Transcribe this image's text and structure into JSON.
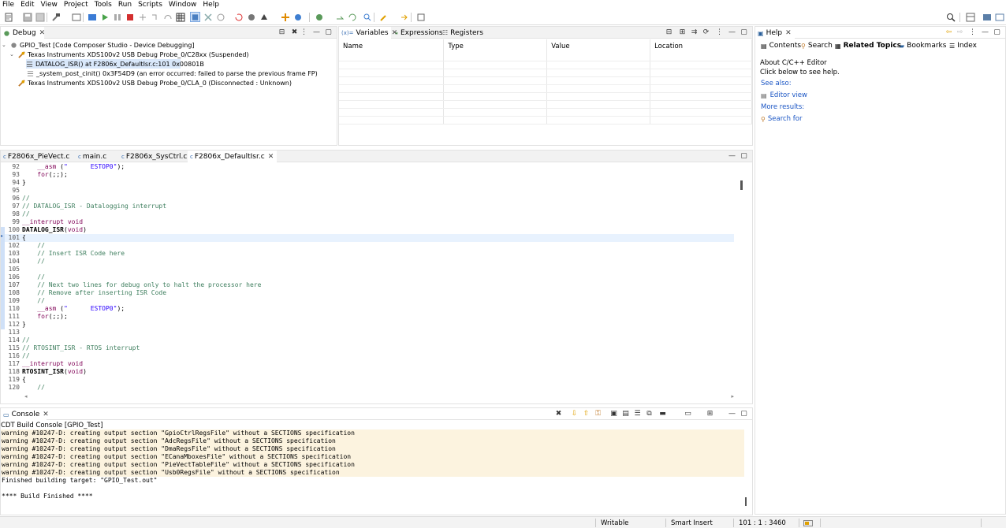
{
  "menu": [
    "File",
    "Edit",
    "View",
    "Project",
    "Tools",
    "Run",
    "Scripts",
    "Window",
    "Help"
  ],
  "debug_view": {
    "tab_label": "Debug",
    "tree": [
      {
        "text": "GPIO_Test [Code Composer Studio - Device Debugging]",
        "icon": "debug-session-icon"
      },
      {
        "text": "Texas Instruments XDS100v2 USB Debug Probe_0/C28xx (Suspended)",
        "icon": "debug-thread-icon"
      },
      {
        "text": "DATALOG_ISR() at F2806x_DefaultIsr.c:101 0x00801B",
        "icon": "stack-frame-icon"
      },
      {
        "text": "_system_post_cinit() 0x3F54D9  (an error occurred: failed to parse the previous frame FP)",
        "icon": "stack-frame-icon"
      },
      {
        "text": "Texas Instruments XDS100v2 USB Debug Probe_0/CLA_0 (Disconnected : Unknown)",
        "icon": "debug-disconnected-icon"
      }
    ]
  },
  "variables_view": {
    "tabs": [
      "Variables",
      "Expressions",
      "Registers"
    ],
    "columns": [
      "Name",
      "Type",
      "Value",
      "Location"
    ]
  },
  "help_view": {
    "tab_label": "Help",
    "tabs": [
      "Contents",
      "Search",
      "Related Topics",
      "Bookmarks",
      "Index"
    ],
    "about_title": "About C/C++ Editor",
    "about_hint": "Click below to see help.",
    "see_also": "See also:",
    "editor_view": "Editor view",
    "more_results": "More results:",
    "search_for": "Search for"
  },
  "editor": {
    "tabs": [
      "F2806x_PieVect.c",
      "main.c",
      "F2806x_SysCtrl.c",
      "F2806x_DefaultIsr.c"
    ],
    "lines": [
      {
        "n": "92",
        "t": "    __asm (\"      ESTOP0\");"
      },
      {
        "n": "93",
        "t": "    for(;;);"
      },
      {
        "n": "94",
        "t": "}"
      },
      {
        "n": "95",
        "t": ""
      },
      {
        "n": "96",
        "t": "//"
      },
      {
        "n": "97",
        "t": "// DATALOG_ISR - Datalogging interrupt"
      },
      {
        "n": "98",
        "t": "//"
      },
      {
        "n": "99",
        "t": "__interrupt void"
      },
      {
        "n": "100",
        "t": "DATALOG_ISR(void)"
      },
      {
        "n": "101",
        "t": "{"
      },
      {
        "n": "102",
        "t": "    //"
      },
      {
        "n": "103",
        "t": "    // Insert ISR Code here"
      },
      {
        "n": "104",
        "t": "    //"
      },
      {
        "n": "105",
        "t": ""
      },
      {
        "n": "106",
        "t": "    //"
      },
      {
        "n": "107",
        "t": "    // Next two lines for debug only to halt the processor here"
      },
      {
        "n": "108",
        "t": "    // Remove after inserting ISR Code"
      },
      {
        "n": "109",
        "t": "    //"
      },
      {
        "n": "110",
        "t": "    __asm (\"      ESTOP0\");"
      },
      {
        "n": "111",
        "t": "    for(;;);"
      },
      {
        "n": "112",
        "t": "}"
      },
      {
        "n": "113",
        "t": ""
      },
      {
        "n": "114",
        "t": "//"
      },
      {
        "n": "115",
        "t": "// RTOSINT_ISR - RTOS interrupt"
      },
      {
        "n": "116",
        "t": "//"
      },
      {
        "n": "117",
        "t": "__interrupt void"
      },
      {
        "n": "118",
        "t": "RTOSINT_ISR(void)"
      },
      {
        "n": "119",
        "t": "{"
      },
      {
        "n": "120",
        "t": "    //"
      }
    ]
  },
  "console": {
    "tab_label": "Console",
    "title": "CDT Build Console [GPIO_Test]",
    "warnings": [
      "warning #10247-D: creating output section \"GpioCtrlRegsFile\" without a SECTIONS specification",
      "warning #10247-D: creating output section \"AdcRegsFile\" without a SECTIONS specification",
      "warning #10247-D: creating output section \"DmaRegsFile\" without a SECTIONS specification",
      "warning #10247-D: creating output section \"ECanaMboxesFile\" without a SECTIONS specification",
      "warning #10247-D: creating output section \"PieVectTableFile\" without a SECTIONS specification",
      "warning #10247-D: creating output section \"Usb0RegsFile\" without a SECTIONS specification"
    ],
    "finished_target": "Finished building target: \"GPIO_Test.out\"",
    "build_finished": "**** Build Finished ****"
  },
  "status": {
    "mode": "Writable",
    "insert": "Smart Insert",
    "position": "101 : 1 : 3460"
  },
  "colors": {
    "accent": "#1a55c4",
    "keyword": "#7f0055",
    "comment": "#3f7f5f",
    "string": "#2a00ff",
    "warning_bg": "#fcf3df",
    "selection": "#d9e8fb"
  }
}
